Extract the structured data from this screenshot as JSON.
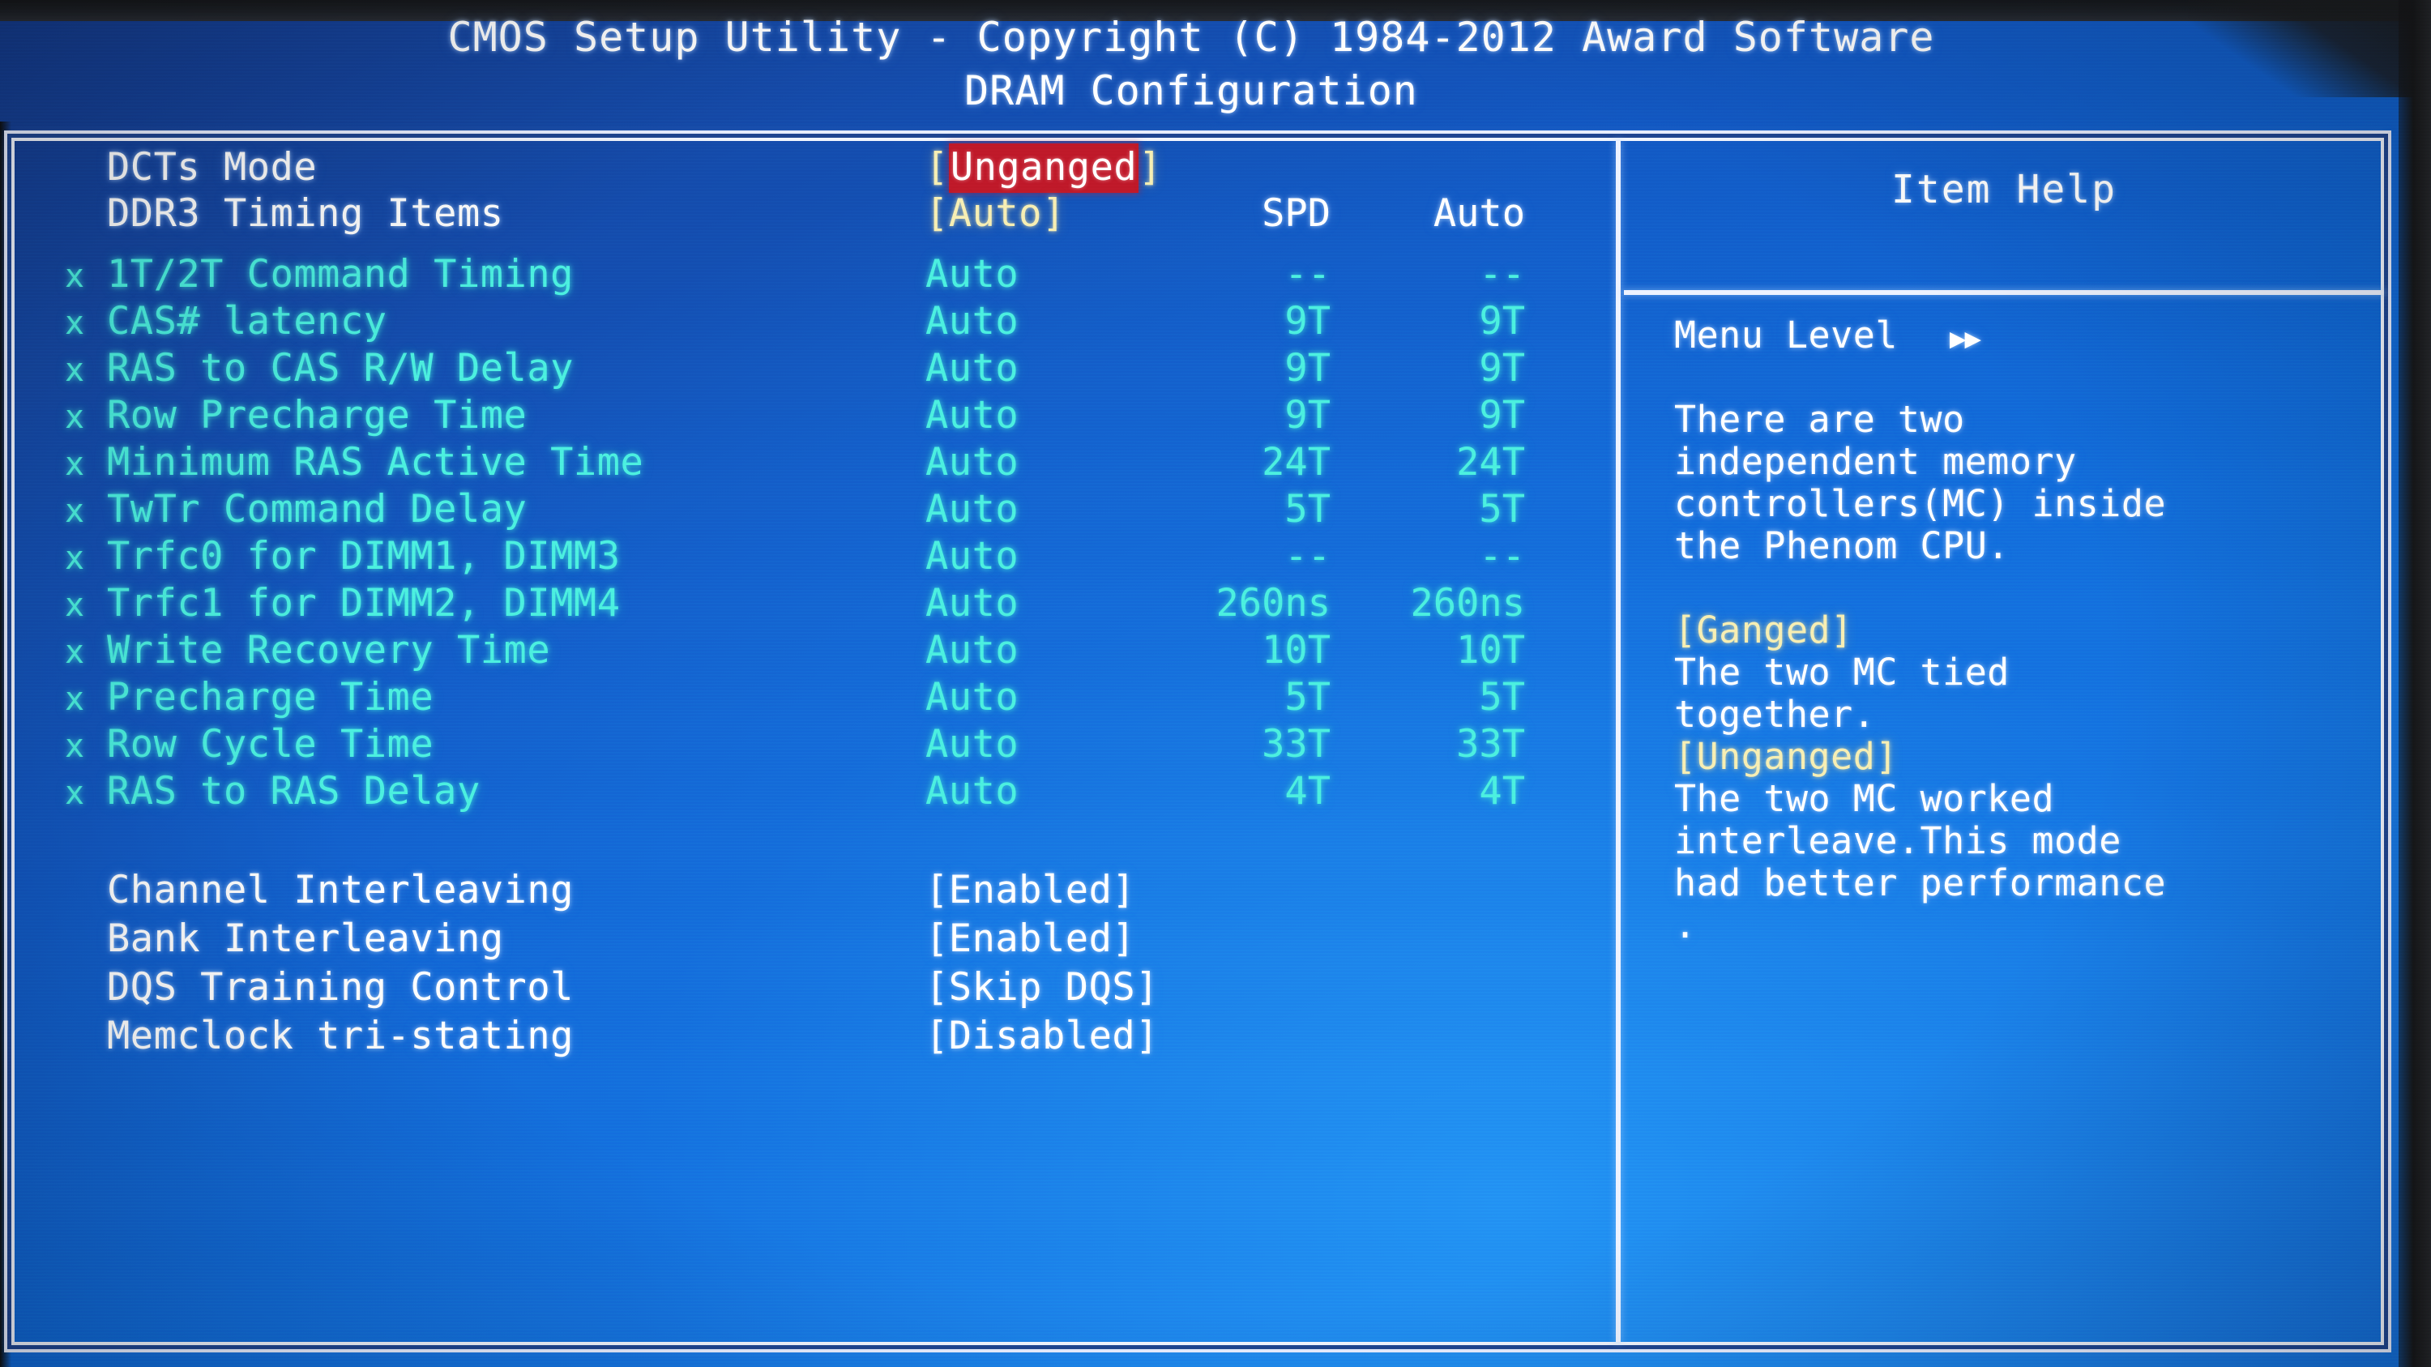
{
  "title": {
    "line1": "CMOS Setup Utility - Copyright (C) 1984-2012 Award Software",
    "line2": "DRAM Configuration"
  },
  "columns": {
    "spd_header": "SPD",
    "auto_header": "Auto"
  },
  "top_options": [
    {
      "label": "DCTs Mode",
      "value_open": "[",
      "value_text": "Unganged",
      "value_close": "]",
      "highlighted": true
    },
    {
      "label": "DDR3 Timing Items",
      "value_open": "[",
      "value_text": "Auto",
      "value_close": "]",
      "highlighted": false,
      "spd": "SPD",
      "auto": "Auto"
    }
  ],
  "timing_rows": [
    {
      "x": "x",
      "label": "1T/2T Command Timing",
      "value": "Auto",
      "spd": "--",
      "auto": "--"
    },
    {
      "x": "x",
      "label": "CAS# latency",
      "value": "Auto",
      "spd": "9T",
      "auto": "9T"
    },
    {
      "x": "x",
      "label": "RAS to CAS R/W Delay",
      "value": "Auto",
      "spd": "9T",
      "auto": "9T"
    },
    {
      "x": "x",
      "label": "Row Precharge Time",
      "value": "Auto",
      "spd": "9T",
      "auto": "9T"
    },
    {
      "x": "x",
      "label": "Minimum RAS Active Time",
      "value": "Auto",
      "spd": "24T",
      "auto": "24T"
    },
    {
      "x": "x",
      "label": "TwTr Command Delay",
      "value": "Auto",
      "spd": "5T",
      "auto": "5T"
    },
    {
      "x": "x",
      "label": "Trfc0 for DIMM1, DIMM3",
      "value": "Auto",
      "spd": "--",
      "auto": "--"
    },
    {
      "x": "x",
      "label": "Trfc1 for DIMM2, DIMM4",
      "value": "Auto",
      "spd": "260ns",
      "auto": "260ns"
    },
    {
      "x": "x",
      "label": "Write Recovery Time",
      "value": "Auto",
      "spd": "10T",
      "auto": "10T"
    },
    {
      "x": "x",
      "label": "Precharge Time",
      "value": "Auto",
      "spd": "5T",
      "auto": "5T"
    },
    {
      "x": "x",
      "label": "Row Cycle Time",
      "value": "Auto",
      "spd": "33T",
      "auto": "33T"
    },
    {
      "x": "x",
      "label": "RAS to RAS Delay",
      "value": "Auto",
      "spd": "4T",
      "auto": "4T"
    }
  ],
  "bottom_options": [
    {
      "label": "Channel Interleaving",
      "value": "[Enabled]"
    },
    {
      "label": "Bank Interleaving",
      "value": "[Enabled]"
    },
    {
      "label": "DQS Training Control",
      "value": "[Skip DQS]"
    },
    {
      "label": "Memclock tri-stating",
      "value": "[Disabled]"
    }
  ],
  "item_help": {
    "header": "Item Help",
    "menu_level_label": "Menu Level",
    "menu_level_arrows": "▶▶",
    "lines": [
      {
        "text": "There are two",
        "color": "white"
      },
      {
        "text": "independent memory",
        "color": "white"
      },
      {
        "text": "controllers(MC) inside",
        "color": "white"
      },
      {
        "text": "the Phenom CPU.",
        "color": "white"
      },
      {
        "text": "",
        "color": "white"
      },
      {
        "text": "[Ganged]",
        "color": "yellow"
      },
      {
        "text": "The two MC tied",
        "color": "white"
      },
      {
        "text": "together.",
        "color": "white"
      },
      {
        "text": "[Unganged]",
        "color": "yellow"
      },
      {
        "text": "The two MC worked",
        "color": "white"
      },
      {
        "text": "interleave.This mode",
        "color": "white"
      },
      {
        "text": "had better performance",
        "color": "white"
      },
      {
        "text": ".",
        "color": "white"
      }
    ]
  },
  "colors": {
    "background_blue": "#1259c4",
    "text_white": "#ffffff",
    "text_cyan": "#4cf0e0",
    "text_yellow": "#f7efb4",
    "highlight_red": "#c0192a",
    "frame_white": "#f2f6ff"
  }
}
